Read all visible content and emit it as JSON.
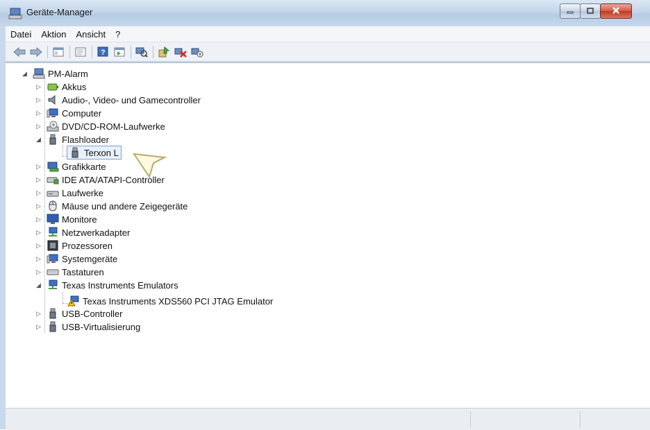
{
  "window": {
    "title": "Geräte-Manager"
  },
  "menu": [
    "Datei",
    "Aktion",
    "Ansicht",
    "?"
  ],
  "toolbar_icons": [
    "back-arrow-icon",
    "forward-arrow-icon",
    "console-tree-icon",
    "properties-icon",
    "help-icon",
    "action-pane-icon",
    "scan-hardware-icon",
    "update-driver-icon",
    "uninstall-icon",
    "disable-device-icon"
  ],
  "tree": {
    "root": "PM-Alarm",
    "items": [
      {
        "label": "Akkus",
        "icon": "battery-icon",
        "state": "collapsed"
      },
      {
        "label": "Audio-, Video- und Gamecontroller",
        "icon": "speaker-icon",
        "state": "collapsed"
      },
      {
        "label": "Computer",
        "icon": "computer-icon",
        "state": "collapsed"
      },
      {
        "label": "DVD/CD-ROM-Laufwerke",
        "icon": "dvd-drive-icon",
        "state": "collapsed"
      },
      {
        "label": "Flashloader",
        "icon": "usb-plug-icon",
        "state": "expanded",
        "children": [
          {
            "label": "Terxon L",
            "icon": "usb-plug-icon",
            "selected": true
          }
        ]
      },
      {
        "label": "Grafikkarte",
        "icon": "display-adapter-icon",
        "state": "collapsed"
      },
      {
        "label": "IDE ATA/ATAPI-Controller",
        "icon": "ide-controller-icon",
        "state": "collapsed"
      },
      {
        "label": "Laufwerke",
        "icon": "disk-drive-icon",
        "state": "collapsed"
      },
      {
        "label": "Mäuse und andere Zeigegeräte",
        "icon": "mouse-icon",
        "state": "collapsed"
      },
      {
        "label": "Monitore",
        "icon": "monitor-icon",
        "state": "collapsed"
      },
      {
        "label": "Netzwerkadapter",
        "icon": "network-adapter-icon",
        "state": "collapsed"
      },
      {
        "label": "Prozessoren",
        "icon": "processor-icon",
        "state": "collapsed"
      },
      {
        "label": "Systemgeräte",
        "icon": "system-device-icon",
        "state": "collapsed"
      },
      {
        "label": "Tastaturen",
        "icon": "keyboard-icon",
        "state": "collapsed"
      },
      {
        "label": "Texas Instruments Emulators",
        "icon": "network-adapter-icon",
        "state": "expanded",
        "children": [
          {
            "label": "Texas Instruments XDS560 PCI JTAG Emulator",
            "icon": "warning-device-icon",
            "selected": false
          }
        ]
      },
      {
        "label": "USB-Controller",
        "icon": "usb-plug-icon",
        "state": "collapsed"
      },
      {
        "label": "USB-Virtualisierung",
        "icon": "usb-plug-icon",
        "state": "collapsed"
      }
    ]
  },
  "colors": {
    "accent": "#7da2ce",
    "titlebar": "#c4d6ea",
    "close": "#c0381f"
  }
}
